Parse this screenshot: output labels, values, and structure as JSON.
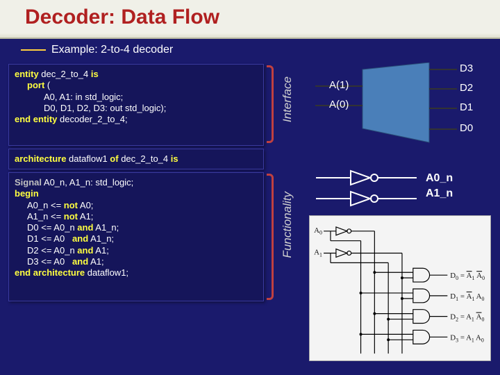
{
  "title": "Decoder: Data Flow",
  "subtitle": "Example: 2-to-4 decoder",
  "labels": {
    "interface": "Interface",
    "functionality": "Functionality"
  },
  "code": {
    "entity": {
      "l1a": "entity",
      "l1b": " dec_2_to_4 ",
      "l1c": "is",
      "l2a": "port",
      "l2b": " (",
      "l3": "A0, A1: in  std_logic;",
      "l4": "D0, D1, D2, D3: out std_logic);",
      "l5a": "end entity",
      "l5b": " decoder_2_to_4;"
    },
    "arch_head": {
      "a": "architecture",
      "b": " dataflow1 ",
      "c": "of",
      "d": " dec_2_to_4 ",
      "e": "is"
    },
    "arch": {
      "s1a": "Signal",
      "s1b": " A0_n, A1_n: std_logic;",
      "s2": "begin",
      "l1a": "A0_n <= ",
      "l1b": "not",
      "l1c": " A0;",
      "l2a": "A1_n <= ",
      "l2b": "not",
      "l2c": " A1;",
      "l3a": "D0 <= A0_n ",
      "l3b": "and",
      "l3c": " A1_n;",
      "l4a": "D1 <= A0   ",
      "l4b": "and",
      "l4c": " A1_n;",
      "l5a": "D2 <= A0_n ",
      "l5b": "and",
      "l5c": " A1;",
      "l6a": "D3 <= A0   ",
      "l6b": "and",
      "l6c": " A1;",
      "ea": "end architecture",
      "eb": " dataflow1;"
    }
  },
  "mux": {
    "A1": "A(1)",
    "A0": "A(0)",
    "D3": "D3",
    "D2": "D2",
    "D1": "D1",
    "D0": "D0"
  },
  "an": {
    "A0": "A0_n",
    "A1": "A1_n"
  },
  "schematic": {
    "inA0": "A",
    "inA0s": "0",
    "inA1": "A",
    "inA1s": "1",
    "out0a": "D",
    "out0as": "0",
    "out0eq": " = ",
    "out1a": "D",
    "out1as": "1",
    "out1eq": " = ",
    "out2a": "D",
    "out2as": "2",
    "out2eq": " = ",
    "out3a": "D",
    "out3as": "3",
    "out3eq": " = ",
    "A0_": "A",
    "A0_s": "0",
    "A1_": "A",
    "A1_s": "1"
  }
}
